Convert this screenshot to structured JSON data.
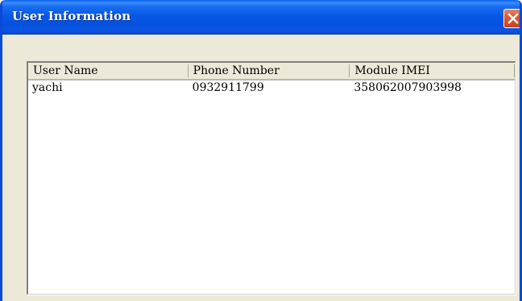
{
  "window": {
    "title": "User Information",
    "close_icon": "close-icon"
  },
  "list": {
    "columns": [
      "User Name",
      "Phone Number",
      "Module IMEI"
    ],
    "rows": [
      [
        "yachi",
        "0932911799",
        "358062007903998"
      ]
    ]
  },
  "colors": {
    "titlebar": "#0758e6",
    "window_bg": "#ece9d8",
    "close_button": "#d95a33"
  }
}
